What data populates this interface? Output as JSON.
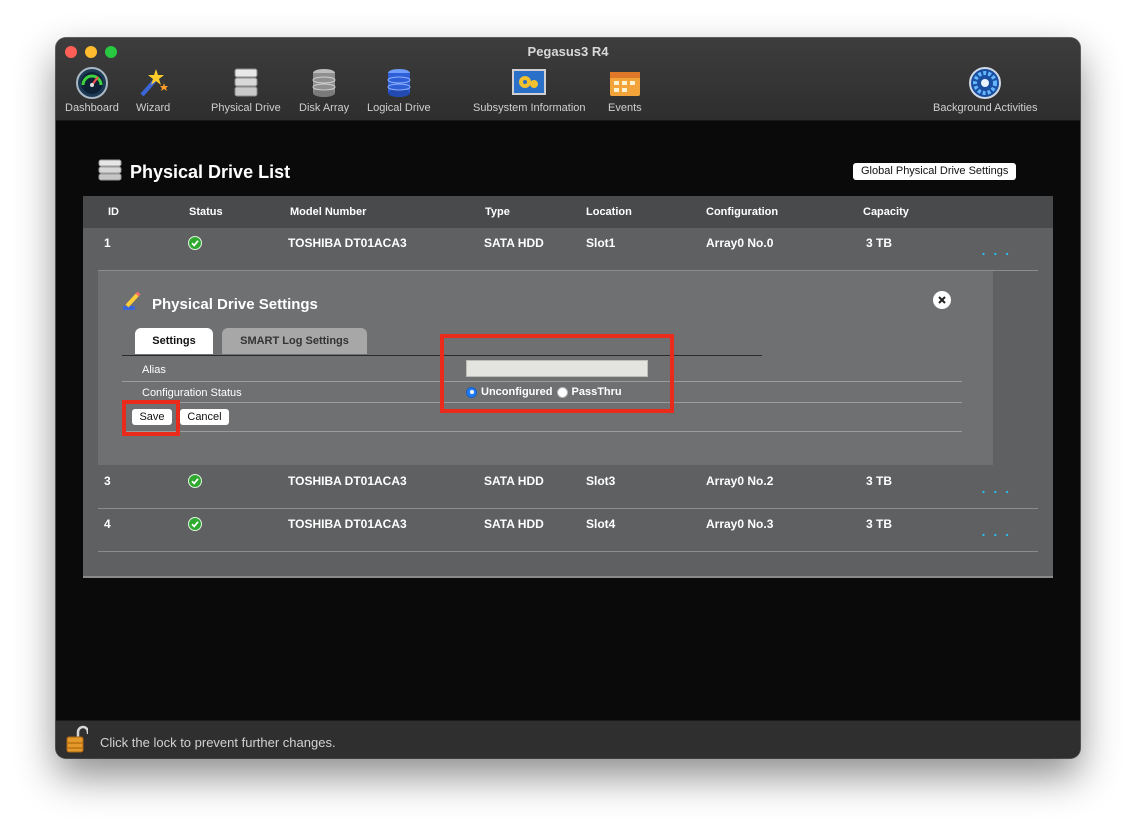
{
  "window": {
    "title": "Pegasus3 R4"
  },
  "toolbar": {
    "dashboard": "Dashboard",
    "wizard": "Wizard",
    "physical_drive": "Physical Drive",
    "disk_array": "Disk Array",
    "logical_drive": "Logical Drive",
    "subsystem_information": "Subsystem Information",
    "events": "Events",
    "background_activities": "Background Activities"
  },
  "page": {
    "title": "Physical Drive List",
    "global_settings_button": "Global Physical Drive Settings"
  },
  "table": {
    "headers": [
      "ID",
      "Status",
      "Model Number",
      "Type",
      "Location",
      "Configuration",
      "Capacity"
    ],
    "rows": [
      {
        "id": "1",
        "status": "ok",
        "model": "TOSHIBA DT01ACA3",
        "type": "SATA HDD",
        "location": "Slot1",
        "configuration": "Array0 No.0",
        "capacity": "3 TB",
        "more": ". . ."
      },
      {
        "id": "3",
        "status": "ok",
        "model": "TOSHIBA DT01ACA3",
        "type": "SATA HDD",
        "location": "Slot3",
        "configuration": "Array0 No.2",
        "capacity": "3 TB",
        "more": ". . ."
      },
      {
        "id": "4",
        "status": "ok",
        "model": "TOSHIBA DT01ACA3",
        "type": "SATA HDD",
        "location": "Slot4",
        "configuration": "Array0 No.3",
        "capacity": "3 TB",
        "more": ". . ."
      }
    ]
  },
  "settings": {
    "title": "Physical Drive Settings",
    "tabs": [
      "Settings",
      "SMART Log Settings"
    ],
    "alias_label": "Alias",
    "alias_value": "",
    "config_status_label": "Configuration Status",
    "config_options": [
      "Unconfigured",
      "PassThru"
    ],
    "config_selected": "Unconfigured",
    "save_label": "Save",
    "cancel_label": "Cancel"
  },
  "footer": {
    "lock_text": "Click the lock to prevent further changes."
  },
  "colors": {
    "highlight": "#ea2a1a",
    "accent_blue": "#2bbbe8",
    "status_ok": "#2fa82f"
  }
}
